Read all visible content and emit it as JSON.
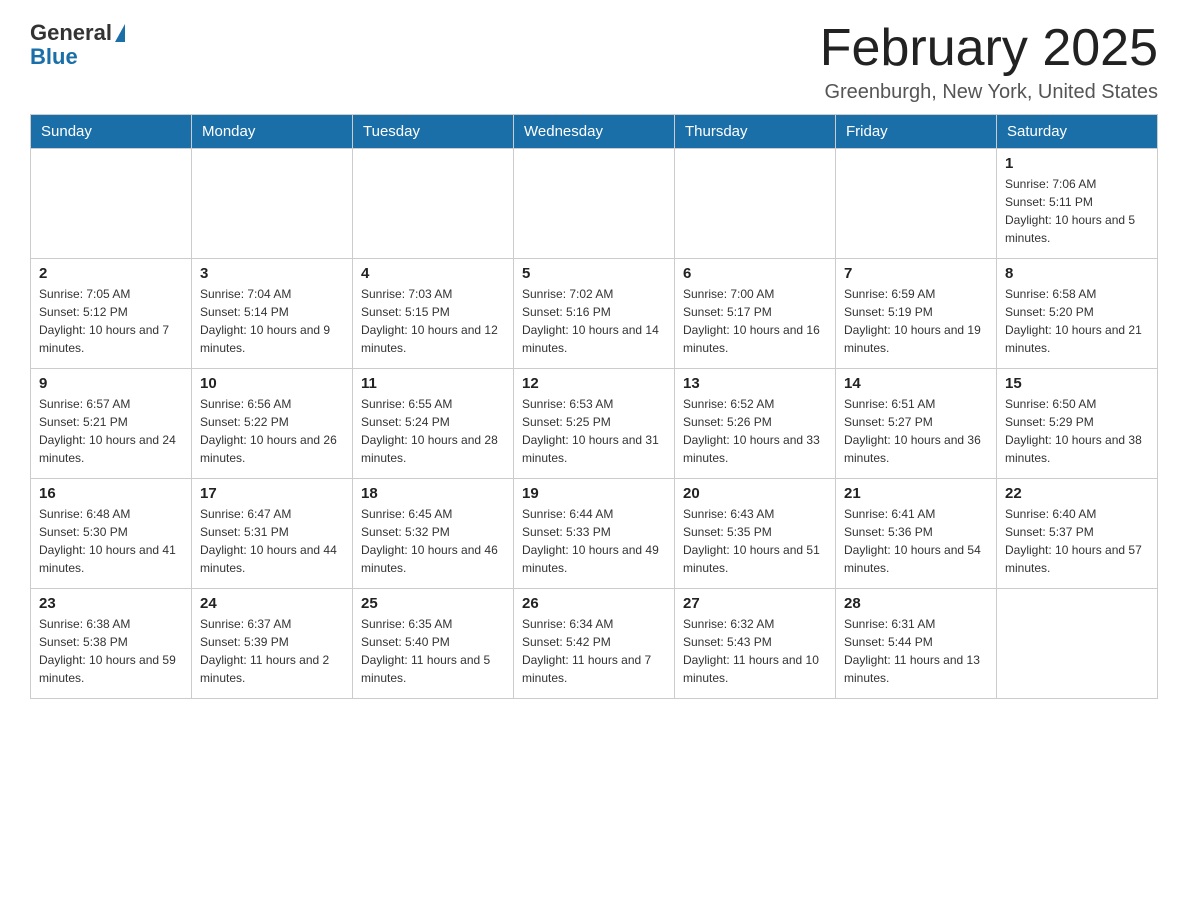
{
  "header": {
    "logo": {
      "general": "General",
      "blue": "Blue"
    },
    "title": "February 2025",
    "location": "Greenburgh, New York, United States"
  },
  "days_of_week": [
    "Sunday",
    "Monday",
    "Tuesday",
    "Wednesday",
    "Thursday",
    "Friday",
    "Saturday"
  ],
  "weeks": [
    {
      "days": [
        {
          "num": "",
          "info": ""
        },
        {
          "num": "",
          "info": ""
        },
        {
          "num": "",
          "info": ""
        },
        {
          "num": "",
          "info": ""
        },
        {
          "num": "",
          "info": ""
        },
        {
          "num": "",
          "info": ""
        },
        {
          "num": "1",
          "info": "Sunrise: 7:06 AM\nSunset: 5:11 PM\nDaylight: 10 hours and 5 minutes."
        }
      ]
    },
    {
      "days": [
        {
          "num": "2",
          "info": "Sunrise: 7:05 AM\nSunset: 5:12 PM\nDaylight: 10 hours and 7 minutes."
        },
        {
          "num": "3",
          "info": "Sunrise: 7:04 AM\nSunset: 5:14 PM\nDaylight: 10 hours and 9 minutes."
        },
        {
          "num": "4",
          "info": "Sunrise: 7:03 AM\nSunset: 5:15 PM\nDaylight: 10 hours and 12 minutes."
        },
        {
          "num": "5",
          "info": "Sunrise: 7:02 AM\nSunset: 5:16 PM\nDaylight: 10 hours and 14 minutes."
        },
        {
          "num": "6",
          "info": "Sunrise: 7:00 AM\nSunset: 5:17 PM\nDaylight: 10 hours and 16 minutes."
        },
        {
          "num": "7",
          "info": "Sunrise: 6:59 AM\nSunset: 5:19 PM\nDaylight: 10 hours and 19 minutes."
        },
        {
          "num": "8",
          "info": "Sunrise: 6:58 AM\nSunset: 5:20 PM\nDaylight: 10 hours and 21 minutes."
        }
      ]
    },
    {
      "days": [
        {
          "num": "9",
          "info": "Sunrise: 6:57 AM\nSunset: 5:21 PM\nDaylight: 10 hours and 24 minutes."
        },
        {
          "num": "10",
          "info": "Sunrise: 6:56 AM\nSunset: 5:22 PM\nDaylight: 10 hours and 26 minutes."
        },
        {
          "num": "11",
          "info": "Sunrise: 6:55 AM\nSunset: 5:24 PM\nDaylight: 10 hours and 28 minutes."
        },
        {
          "num": "12",
          "info": "Sunrise: 6:53 AM\nSunset: 5:25 PM\nDaylight: 10 hours and 31 minutes."
        },
        {
          "num": "13",
          "info": "Sunrise: 6:52 AM\nSunset: 5:26 PM\nDaylight: 10 hours and 33 minutes."
        },
        {
          "num": "14",
          "info": "Sunrise: 6:51 AM\nSunset: 5:27 PM\nDaylight: 10 hours and 36 minutes."
        },
        {
          "num": "15",
          "info": "Sunrise: 6:50 AM\nSunset: 5:29 PM\nDaylight: 10 hours and 38 minutes."
        }
      ]
    },
    {
      "days": [
        {
          "num": "16",
          "info": "Sunrise: 6:48 AM\nSunset: 5:30 PM\nDaylight: 10 hours and 41 minutes."
        },
        {
          "num": "17",
          "info": "Sunrise: 6:47 AM\nSunset: 5:31 PM\nDaylight: 10 hours and 44 minutes."
        },
        {
          "num": "18",
          "info": "Sunrise: 6:45 AM\nSunset: 5:32 PM\nDaylight: 10 hours and 46 minutes."
        },
        {
          "num": "19",
          "info": "Sunrise: 6:44 AM\nSunset: 5:33 PM\nDaylight: 10 hours and 49 minutes."
        },
        {
          "num": "20",
          "info": "Sunrise: 6:43 AM\nSunset: 5:35 PM\nDaylight: 10 hours and 51 minutes."
        },
        {
          "num": "21",
          "info": "Sunrise: 6:41 AM\nSunset: 5:36 PM\nDaylight: 10 hours and 54 minutes."
        },
        {
          "num": "22",
          "info": "Sunrise: 6:40 AM\nSunset: 5:37 PM\nDaylight: 10 hours and 57 minutes."
        }
      ]
    },
    {
      "days": [
        {
          "num": "23",
          "info": "Sunrise: 6:38 AM\nSunset: 5:38 PM\nDaylight: 10 hours and 59 minutes."
        },
        {
          "num": "24",
          "info": "Sunrise: 6:37 AM\nSunset: 5:39 PM\nDaylight: 11 hours and 2 minutes."
        },
        {
          "num": "25",
          "info": "Sunrise: 6:35 AM\nSunset: 5:40 PM\nDaylight: 11 hours and 5 minutes."
        },
        {
          "num": "26",
          "info": "Sunrise: 6:34 AM\nSunset: 5:42 PM\nDaylight: 11 hours and 7 minutes."
        },
        {
          "num": "27",
          "info": "Sunrise: 6:32 AM\nSunset: 5:43 PM\nDaylight: 11 hours and 10 minutes."
        },
        {
          "num": "28",
          "info": "Sunrise: 6:31 AM\nSunset: 5:44 PM\nDaylight: 11 hours and 13 minutes."
        },
        {
          "num": "",
          "info": ""
        }
      ]
    }
  ]
}
